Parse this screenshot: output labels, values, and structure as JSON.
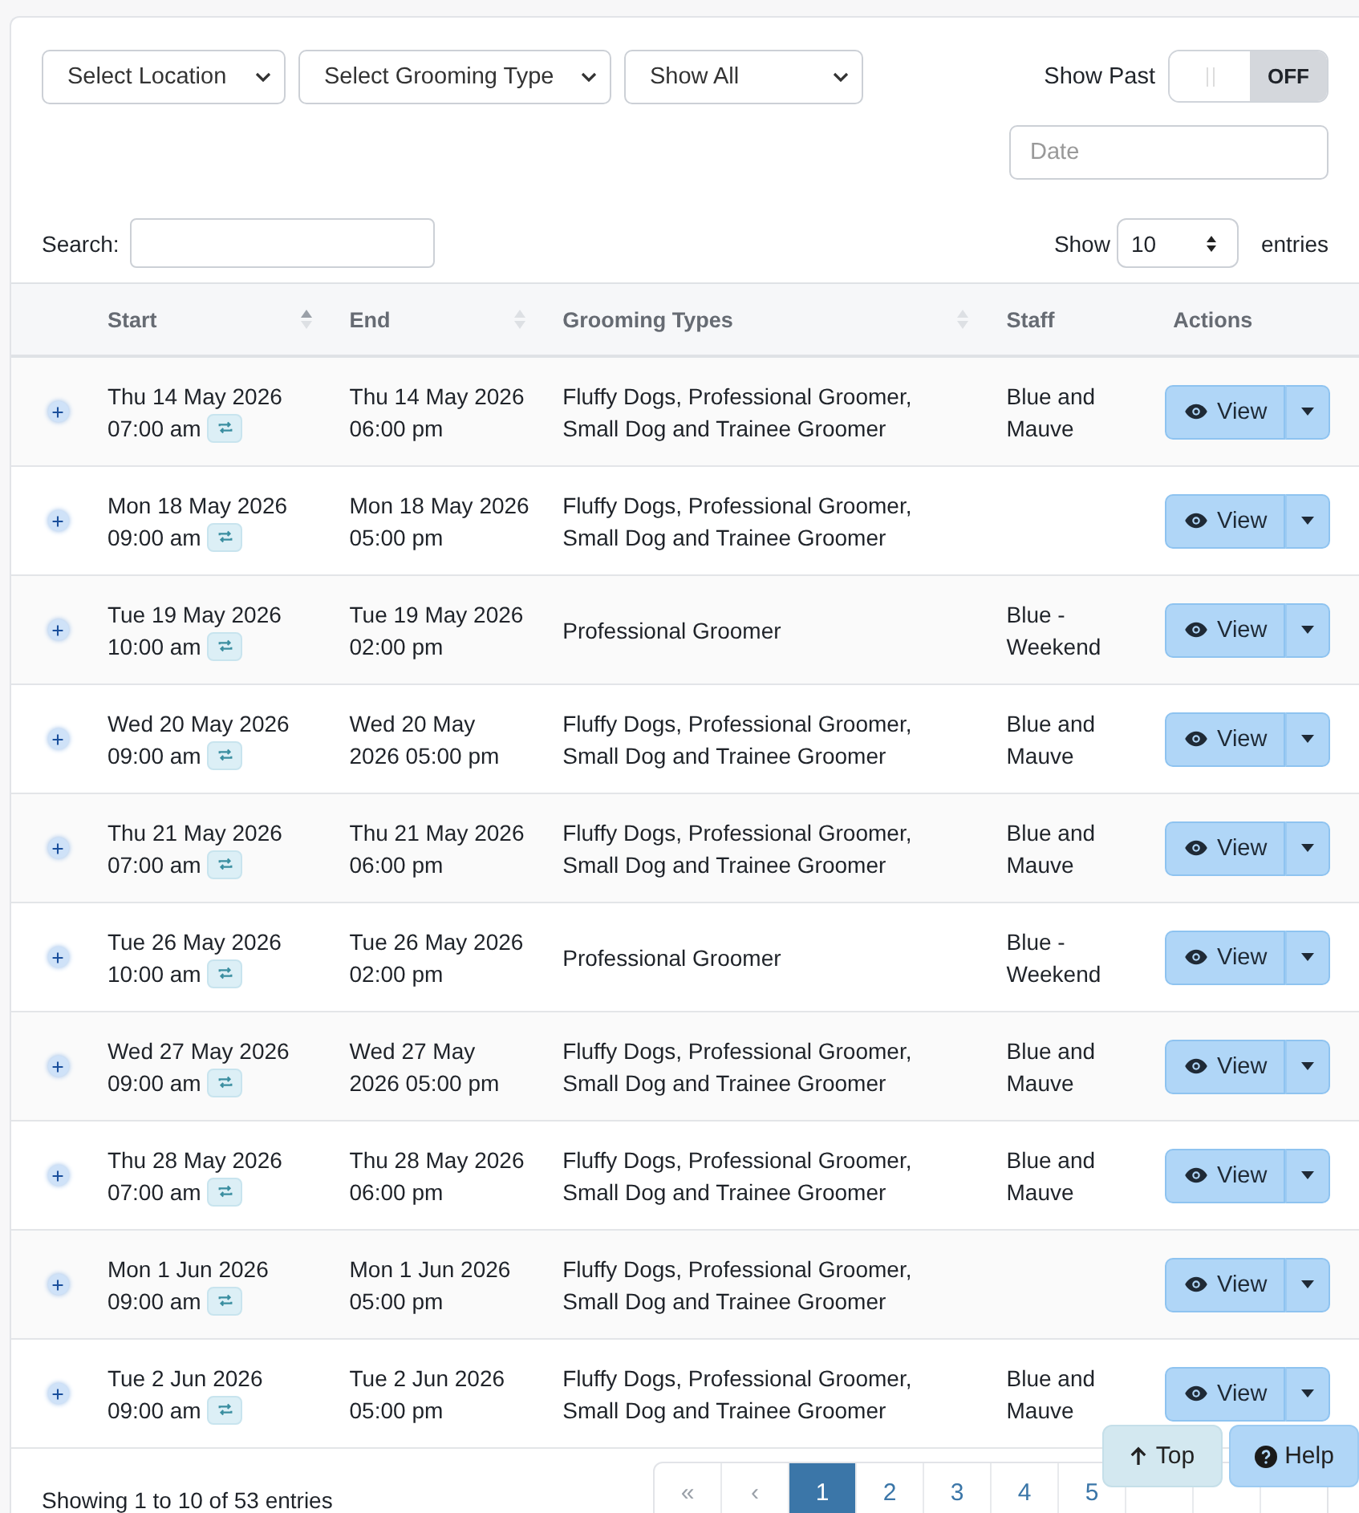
{
  "filters": {
    "selects": [
      "Select Location",
      "Select Grooming Type",
      "Show All"
    ],
    "show_past": {
      "label": "Show Past",
      "on": false,
      "state_text": "OFF"
    },
    "date": {
      "placeholder": "Date"
    }
  },
  "search": {
    "label": "Search:"
  },
  "length": {
    "prefix": "Show",
    "value": "10",
    "suffix": "entries"
  },
  "table": {
    "columns": [
      {
        "label": "Start",
        "sortable": true,
        "sorted": true
      },
      {
        "label": "End",
        "sortable": true,
        "sorted": false
      },
      {
        "label": "Grooming Types",
        "sortable": true,
        "sorted": false
      },
      {
        "label": "Staff"
      },
      {
        "label": "Actions"
      }
    ],
    "rows": [
      {
        "start_date": "Thu 14 May 2026",
        "start_time": "07:00 am",
        "end": [
          "Thu 14 May 2026",
          "06:00 pm"
        ],
        "types": [
          "Fluffy Dogs, Professional Groomer,",
          "Small Dog and Trainee Groomer"
        ],
        "staff": [
          "Blue and",
          "Mauve"
        ],
        "action": "View"
      },
      {
        "start_date": "Mon 18 May 2026",
        "start_time": "09:00 am",
        "end": [
          "Mon 18 May 2026",
          "05:00 pm"
        ],
        "types": [
          "Fluffy Dogs, Professional Groomer,",
          "Small Dog and Trainee Groomer"
        ],
        "action": "View"
      },
      {
        "start_date": "Tue 19 May 2026",
        "start_time": "10:00 am",
        "end": [
          "Tue 19 May 2026",
          "02:00 pm"
        ],
        "types": [
          "Professional Groomer"
        ],
        "staff": [
          "Blue -",
          "Weekend"
        ],
        "action": "View"
      },
      {
        "start_date": "Wed 20 May 2026",
        "start_time": "09:00 am",
        "end": [
          "Wed 20 May",
          "2026 05:00 pm"
        ],
        "types": [
          "Fluffy Dogs, Professional Groomer,",
          "Small Dog and Trainee Groomer"
        ],
        "staff": [
          "Blue and",
          "Mauve"
        ],
        "action": "View"
      },
      {
        "start_date": "Thu 21 May 2026",
        "start_time": "07:00 am",
        "end": [
          "Thu 21 May 2026",
          "06:00 pm"
        ],
        "types": [
          "Fluffy Dogs, Professional Groomer,",
          "Small Dog and Trainee Groomer"
        ],
        "staff": [
          "Blue and",
          "Mauve"
        ],
        "action": "View"
      },
      {
        "start_date": "Tue 26 May 2026",
        "start_time": "10:00 am",
        "end": [
          "Tue 26 May 2026",
          "02:00 pm"
        ],
        "types": [
          "Professional Groomer"
        ],
        "staff": [
          "Blue -",
          "Weekend"
        ],
        "action": "View"
      },
      {
        "start_date": "Wed 27 May 2026",
        "start_time": "09:00 am",
        "end": [
          "Wed 27 May",
          "2026 05:00 pm"
        ],
        "types": [
          "Fluffy Dogs, Professional Groomer,",
          "Small Dog and Trainee Groomer"
        ],
        "staff": [
          "Blue and",
          "Mauve"
        ],
        "action": "View"
      },
      {
        "start_date": "Thu 28 May 2026",
        "start_time": "07:00 am",
        "end": [
          "Thu 28 May 2026",
          "06:00 pm"
        ],
        "types": [
          "Fluffy Dogs, Professional Groomer,",
          "Small Dog and Trainee Groomer"
        ],
        "staff": [
          "Blue and",
          "Mauve"
        ],
        "action": "View"
      },
      {
        "start_date": "Mon 1 Jun 2026",
        "start_time": "09:00 am",
        "end": [
          "Mon 1 Jun 2026",
          "05:00 pm"
        ],
        "types": [
          "Fluffy Dogs, Professional Groomer,",
          "Small Dog and Trainee Groomer"
        ],
        "action": "View"
      },
      {
        "start_date": "Tue 2 Jun 2026",
        "start_time": "09:00 am",
        "end": [
          "Tue 2 Jun 2026",
          "05:00 pm"
        ],
        "types": [
          "Fluffy Dogs, Professional Groomer,",
          "Small Dog and Trainee Groomer"
        ],
        "staff": [
          "Blue and",
          "Mauve"
        ],
        "action": "View"
      }
    ]
  },
  "info": "Showing 1 to 10 of 53 entries",
  "pagination": [
    {
      "label": "«",
      "selected": false
    },
    {
      "label": "‹",
      "selected": false
    },
    {
      "label": "1",
      "selected": true
    },
    {
      "label": "2",
      "selected": false
    },
    {
      "label": "3",
      "selected": false
    },
    {
      "label": "4",
      "selected": false
    },
    {
      "label": "5",
      "selected": false
    }
  ],
  "floating": {
    "top": "Top",
    "help": "Help"
  }
}
